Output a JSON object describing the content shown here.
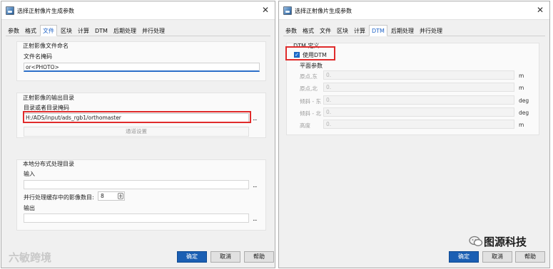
{
  "left_dialog": {
    "title": "选择正射像片生成参数",
    "close": "✕",
    "tabs": [
      "参数",
      "格式",
      "文件",
      "区块",
      "计算",
      "DTM",
      "后期处理",
      "并行处理"
    ],
    "active_tab": "文件",
    "file_naming": {
      "group_label": "正射影像文件命名",
      "mask_label": "文件名掩码",
      "mask_value": "or<PHOTO>"
    },
    "output_dir": {
      "group_label": "正射影像的输出目录",
      "dir_label": "目录或者目录掩码",
      "dir_value": "H:/ADS/input/ads_rgb1/orthomaster",
      "browse": "...",
      "channel_button": "通道设置"
    },
    "distributed": {
      "group_label": "本地分布式处理目录",
      "input_label": "输入",
      "input_value": "",
      "browse": "...",
      "buffer_label": "并行处理缓存中的影像数目:",
      "buffer_value": "8",
      "output_label": "输出",
      "output_value": ""
    },
    "buttons": {
      "ok": "确定",
      "cancel": "取消",
      "help": "帮助"
    }
  },
  "right_dialog": {
    "title": "选择正射像片生成参数",
    "close": "✕",
    "tabs": [
      "参数",
      "格式",
      "文件",
      "区块",
      "计算",
      "DTM",
      "后期处理",
      "并行处理"
    ],
    "active_tab": "DTM",
    "dtm": {
      "group_label": "DTM 定义",
      "use_dtm_label": "使用DTM",
      "use_dtm_checked": true,
      "plane_params_label": "平面参数",
      "params": [
        {
          "label": "原点,东",
          "placeholder": "0.",
          "unit": "m"
        },
        {
          "label": "原点,北",
          "placeholder": "0.",
          "unit": "m"
        },
        {
          "label": "倾斜 - 东",
          "placeholder": "0.",
          "unit": "deg"
        },
        {
          "label": "倾斜 - 北",
          "placeholder": "0.",
          "unit": "deg"
        },
        {
          "label": "高度",
          "placeholder": "0.",
          "unit": "m"
        }
      ]
    },
    "buttons": {
      "ok": "确定",
      "cancel": "取消",
      "help": "帮助"
    }
  },
  "watermarks": {
    "left": "六敏跨境",
    "brand": "图源科技"
  },
  "colors": {
    "accent": "#1b5fb3",
    "highlight": "#e02b2b",
    "active_tab": "#1f63c6"
  }
}
